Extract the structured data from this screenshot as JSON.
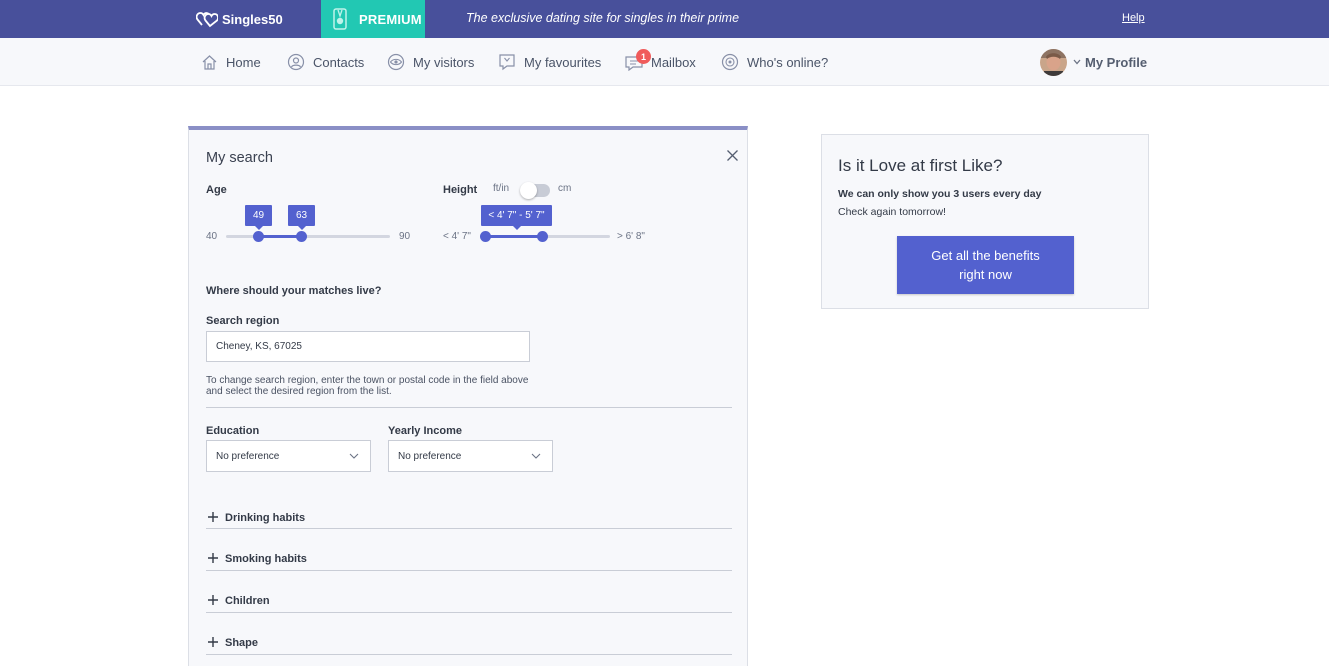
{
  "topbar": {
    "logo_text": "Singles50",
    "premium_label": "PREMIUM",
    "tagline": "The exclusive dating site for singles in their prime",
    "help_label": "Help",
    "bg_color": "#48509b",
    "premium_color": "#22c8b3"
  },
  "nav": {
    "items": [
      {
        "label": "Home",
        "icon": "home-icon"
      },
      {
        "label": "Contacts",
        "icon": "user-circle-icon"
      },
      {
        "label": "My visitors",
        "icon": "eye-icon"
      },
      {
        "label": "My favourites",
        "icon": "bookmark-icon"
      },
      {
        "label": "Mailbox",
        "icon": "mail-icon",
        "badge": "1"
      },
      {
        "label": "Who's online?",
        "icon": "online-icon"
      }
    ],
    "profile_label": "My Profile"
  },
  "search": {
    "title": "My search",
    "age": {
      "label": "Age",
      "min_label": "40",
      "max_label": "90",
      "low": "49",
      "high": "63"
    },
    "height": {
      "label": "Height",
      "unit_left": "ft/in",
      "unit_right": "cm",
      "range_text": "< 4' 7\" - 5' 7\"",
      "min_label": "< 4' 7\"",
      "max_label": "> 6' 8\""
    },
    "location_heading": "Where should your matches live?",
    "region_label": "Search region",
    "region_value": "Cheney, KS, 67025",
    "region_hint": "To change search region, enter the town or postal code in the field above and select the desired region from the list.",
    "education_label": "Education",
    "education_value": "No preference",
    "income_label": "Yearly Income",
    "income_value": "No preference",
    "accordions": [
      "Drinking habits",
      "Smoking habits",
      "Children",
      "Shape"
    ],
    "accent_color": "#5361cf"
  },
  "likebox": {
    "title": "Is it Love at first Like?",
    "bold_text": "We can only show you 3 users every day",
    "sub_text": "Check again tomorrow!",
    "cta_label": "Get all the benefits right now"
  }
}
